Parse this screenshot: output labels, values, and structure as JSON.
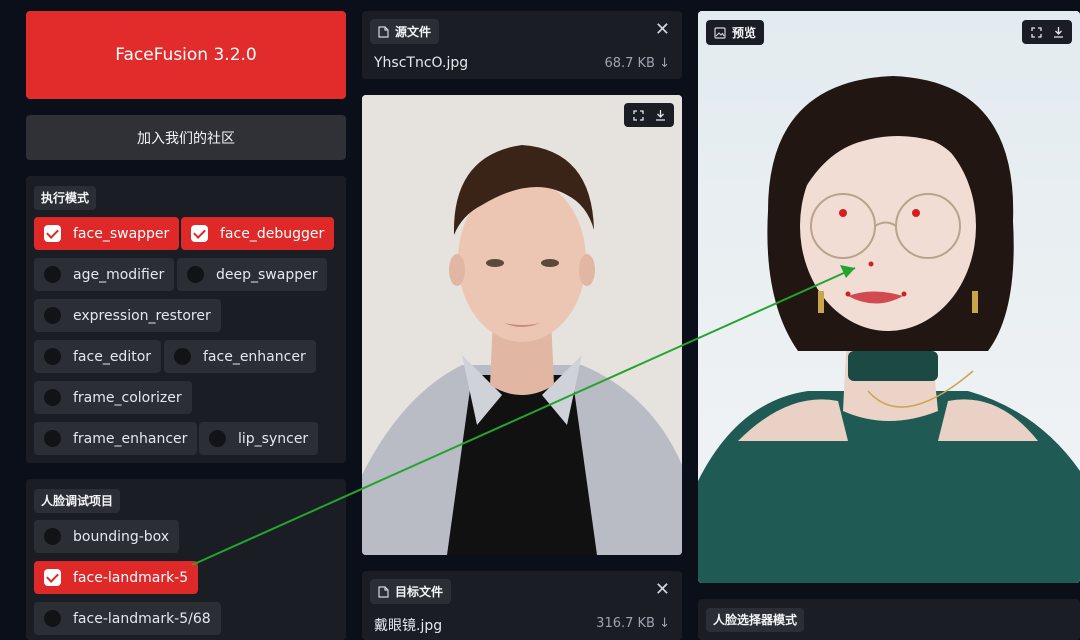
{
  "app": {
    "title": "FaceFusion 3.2.0",
    "community": "加入我们的社区"
  },
  "processors": {
    "label": "执行模式",
    "items": [
      {
        "name": "face_swapper",
        "checked": true
      },
      {
        "name": "face_debugger",
        "checked": true
      },
      {
        "name": "age_modifier",
        "checked": false
      },
      {
        "name": "deep_swapper",
        "checked": false
      },
      {
        "name": "expression_restorer",
        "checked": false
      },
      {
        "name": "face_editor",
        "checked": false
      },
      {
        "name": "face_enhancer",
        "checked": false
      },
      {
        "name": "frame_colorizer",
        "checked": false
      },
      {
        "name": "frame_enhancer",
        "checked": false
      },
      {
        "name": "lip_syncer",
        "checked": false
      }
    ]
  },
  "debugger": {
    "label": "人脸调试项目",
    "items": [
      {
        "name": "bounding-box",
        "checked": false
      },
      {
        "name": "face-landmark-5",
        "checked": true
      },
      {
        "name": "face-landmark-5/68",
        "checked": false
      }
    ]
  },
  "source": {
    "label": "源文件",
    "filename": "YhscTncO.jpg",
    "size": "68.7 KB ↓"
  },
  "target": {
    "label": "目标文件",
    "filename": "戴眼镜.jpg",
    "size": "316.7 KB ↓"
  },
  "preview": {
    "label": "预览"
  },
  "face_selector": {
    "label": "人脸选择器模式"
  },
  "colors": {
    "accent": "#e22b2b",
    "arrow": "#22a52c"
  }
}
